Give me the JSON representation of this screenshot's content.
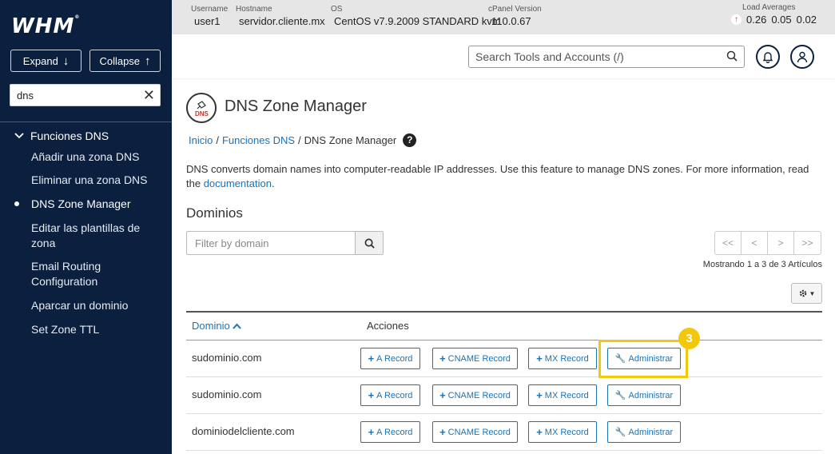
{
  "sidebar": {
    "logo": "WHM",
    "expand_label": "Expand",
    "collapse_label": "Collapse",
    "search_value": "dns",
    "category": "Funciones DNS",
    "items": [
      {
        "label": "Añadir una zona DNS",
        "active": false
      },
      {
        "label": "Eliminar una zona DNS",
        "active": false
      },
      {
        "label": "DNS Zone Manager",
        "active": true
      },
      {
        "label": "Editar las plantillas de zona",
        "active": false
      },
      {
        "label": "Email Routing Configuration",
        "active": false
      },
      {
        "label": "Aparcar un dominio",
        "active": false
      },
      {
        "label": "Set Zone TTL",
        "active": false
      }
    ]
  },
  "topbar": {
    "username_label": "Username",
    "username": "user1",
    "hostname_label": "Hostname",
    "hostname": "servidor.cliente.mx",
    "os_label": "OS",
    "os": "CentOS v7.9.2009 STANDARD kvm",
    "cpanel_label": "cPanel Version",
    "cpanel": "110.0.67",
    "load_label": "Load Averages",
    "load": [
      "0.26",
      "0.05",
      "0.02"
    ]
  },
  "header": {
    "search_placeholder": "Search Tools and Accounts (/)"
  },
  "page": {
    "icon_text": "DNS",
    "title": "DNS Zone Manager",
    "breadcrumb": {
      "home": "Inicio",
      "sep": "/",
      "section": "Funciones DNS",
      "current": "DNS Zone Manager"
    },
    "help_icon": "?",
    "description_pre": "DNS converts domain names into computer-readable IP addresses. Use this feature to manage DNS zones. For more information, read the ",
    "description_link": "documentation",
    "description_post": ".",
    "section_title": "Dominios",
    "filter_placeholder": "Filter by domain",
    "pager": [
      "<<",
      "<",
      ">",
      ">>"
    ],
    "showing": "Mostrando 1 a 3 de 3 Artículos"
  },
  "table": {
    "col_domain": "Dominio",
    "col_actions": "Acciones",
    "btn_a": "A Record",
    "btn_cname": "CNAME Record",
    "btn_mx": "MX Record",
    "btn_admin": "Administrar",
    "rows": [
      {
        "domain": "sudominio.com"
      },
      {
        "domain": "sudominio.com"
      },
      {
        "domain": "dominiodelcliente.com"
      }
    ]
  },
  "annotation": {
    "step": "3",
    "color": "#f2c80f"
  },
  "colors": {
    "sidebar_bg": "#0b1f3f",
    "link": "#1a73b8",
    "topbar_bg": "#e6e6e6"
  }
}
